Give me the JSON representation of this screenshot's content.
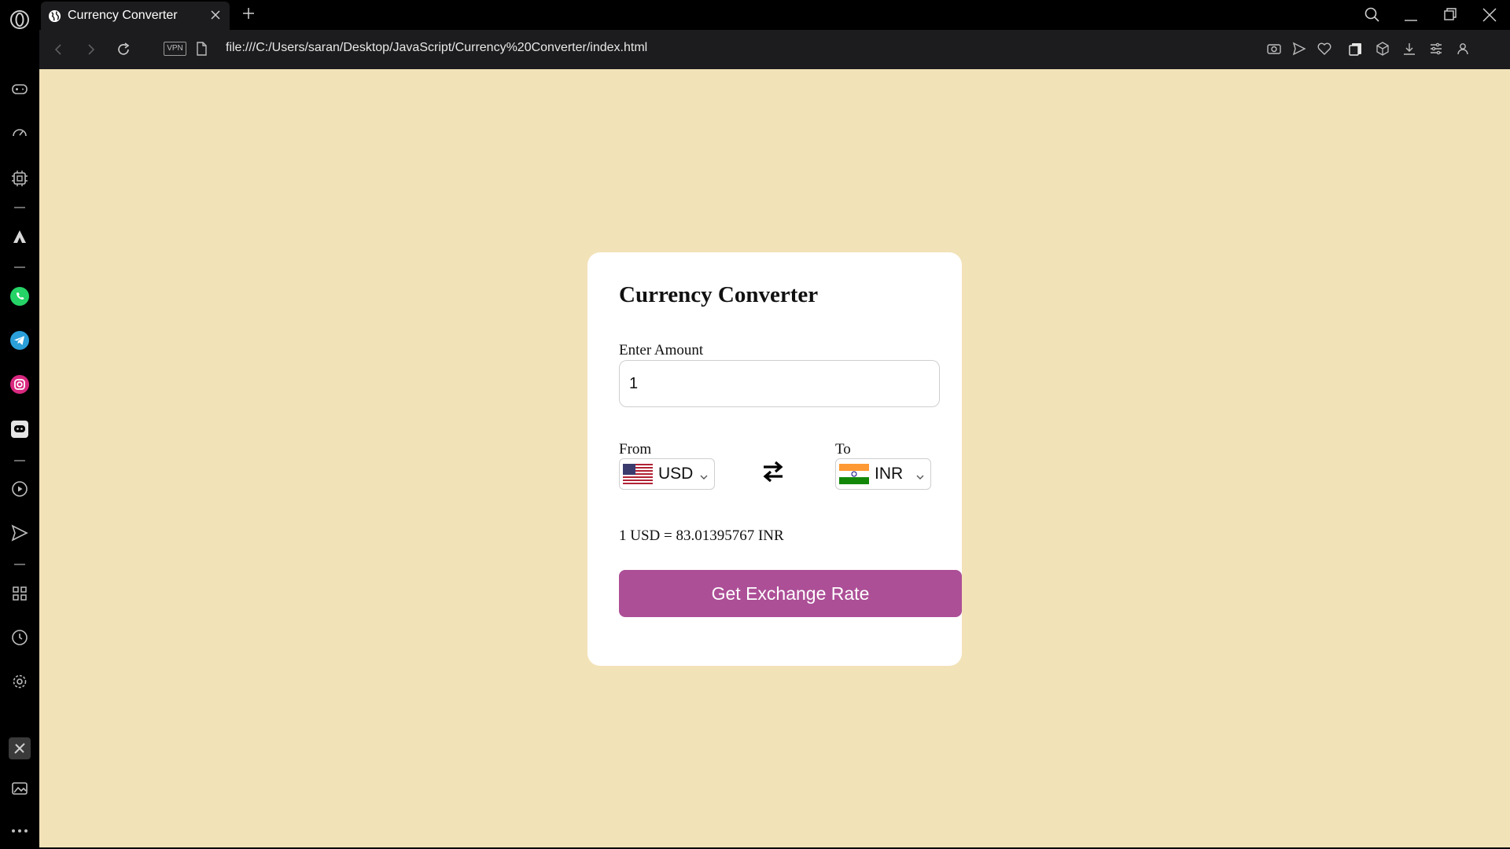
{
  "browser": {
    "tab": {
      "title": "Currency Converter"
    },
    "address_bar": {
      "vpn_label": "VPN",
      "url": "file:///C:/Users/saran/Desktop/JavaScript/Currency%20Converter/index.html"
    },
    "sidebar_icons": [
      "opera-logo-icon",
      "gamepad-icon",
      "speed-dial-icon",
      "cpu-icon",
      "aria-ai-icon",
      "whatsapp-icon",
      "telegram-icon",
      "instagram-icon",
      "discord-icon",
      "player-icon",
      "send-icon",
      "apps-grid-icon",
      "history-clock-icon",
      "settings-gear-icon",
      "pinboard-icon",
      "gallery-icon",
      "more-dots-icon"
    ],
    "toolbar_icons": [
      "snapshot-camera-icon",
      "flow-send-icon",
      "heart-icon",
      "tabs-icon",
      "cube-icon",
      "download-icon",
      "easy-setup-icon",
      "profile-icon"
    ]
  },
  "converter": {
    "title": "Currency Converter",
    "amount_label": "Enter Amount",
    "amount_value": "1",
    "from": {
      "label": "From",
      "selected": "USD",
      "flag": "us-flag-icon"
    },
    "to": {
      "label": "To",
      "selected": "INR",
      "flag": "india-flag-icon"
    },
    "exchange_text": "1 USD = 83.01395767 INR",
    "button_label": "Get Exchange Rate"
  },
  "colors": {
    "page_background": "#f2e2b8",
    "card_background": "#ffffff",
    "button_background": "#ac4f97",
    "browser_chrome": "#000000",
    "address_bar": "#1c1c1e"
  }
}
